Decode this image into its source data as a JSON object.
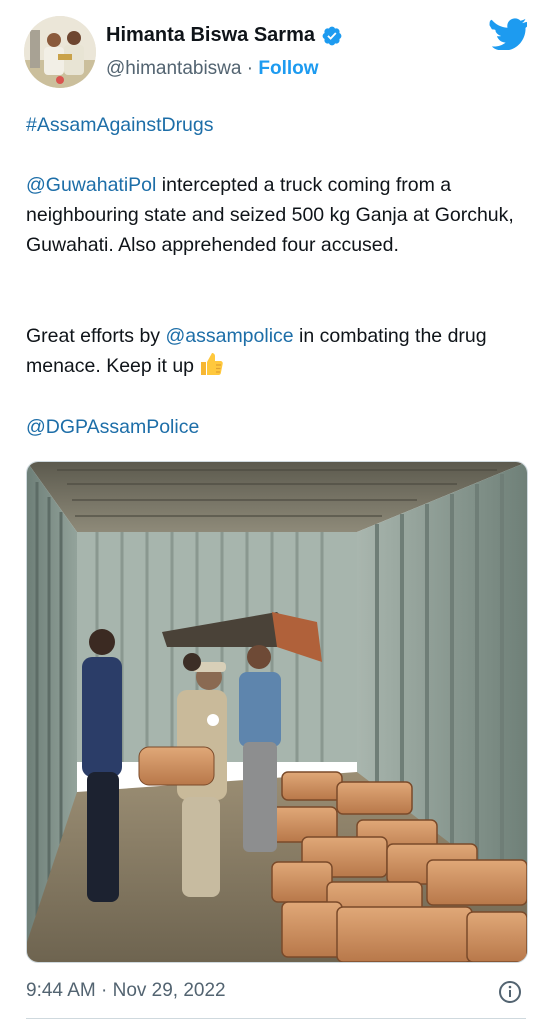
{
  "author": {
    "display_name": "Himanta Biswa Sarma",
    "handle": "@himantabiswa",
    "separator": "·",
    "follow_label": "Follow",
    "verified": true
  },
  "tweet": {
    "hashtag": "#AssamAgainstDrugs",
    "p1_mention": "@GuwahatiPol",
    "p1_text": " intercepted a truck coming from a neighbouring state and seized 500 kg Ganja at Gorchuk, Guwahati. Also apprehended four accused.",
    "p2_prefix": "Great efforts by ",
    "p2_mention": "@assampolice",
    "p2_suffix": " in combating the drug menace. Keep it up",
    "emoji": "thumbs-up",
    "p3_mention": "@DGPAssamPolice",
    "timestamp": "9:44 AM · Nov 29, 2022"
  },
  "icons": {
    "brand": "twitter-bird-icon",
    "verified": "verified-badge-icon",
    "info": "info-icon"
  },
  "colors": {
    "link": "#1d6ea8",
    "follow": "#1d9bf0",
    "twitter_blue": "#1d9bf0",
    "secondary_text": "#536471"
  }
}
